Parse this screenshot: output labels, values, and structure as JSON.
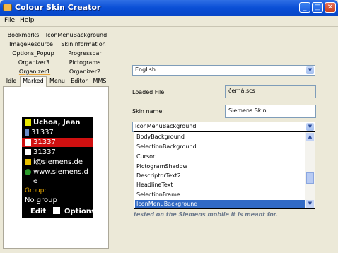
{
  "window": {
    "title": "Colour Skin Creator"
  },
  "menu": [
    "File",
    "Help"
  ],
  "tabs": {
    "row1": [
      "Bookmarks",
      "IconMenuBackground"
    ],
    "row2": [
      "ImageResource",
      "SkinInformation"
    ],
    "row3": [
      "Options_Popup",
      "Progressbar"
    ],
    "row4": [
      "Organizer3",
      "Pictograms"
    ],
    "row5": [
      "Organizer1",
      "Organizer2"
    ],
    "row6": [
      "Idle",
      "Marked",
      "Menu",
      "Editor",
      "MMS"
    ],
    "active": "Marked"
  },
  "phone": {
    "header": "Uchoa, Jean",
    "lines": [
      "31337",
      "31337",
      "31337",
      "i@siemens.de",
      "www.siemens.d",
      "e"
    ],
    "group_label": "Group:",
    "group_value": "No group",
    "soft_left": "Edit",
    "soft_right": "Options"
  },
  "form": {
    "language": "English",
    "loaded_file_label": "Loaded File:",
    "loaded_file_value": "černá.scs",
    "skin_name_label": "Skin name:",
    "skin_name_value": "Siemens Skin",
    "element_combo": "IconMenuBackground",
    "dropdown_items": [
      "BodyBackground",
      "SelectionBackground",
      "Cursor",
      "PictogramShadow",
      "DescriptorText2",
      "HeadlineText",
      "SelectionFrame",
      "IconMenuBackground"
    ],
    "selected_item": "IconMenuBackground",
    "note": "tested on the Siemens mobile it is meant for."
  },
  "colors": {
    "titlebar": "#0a4fd6",
    "selection": "#316ac5",
    "phone_highlight": "#d01010"
  }
}
